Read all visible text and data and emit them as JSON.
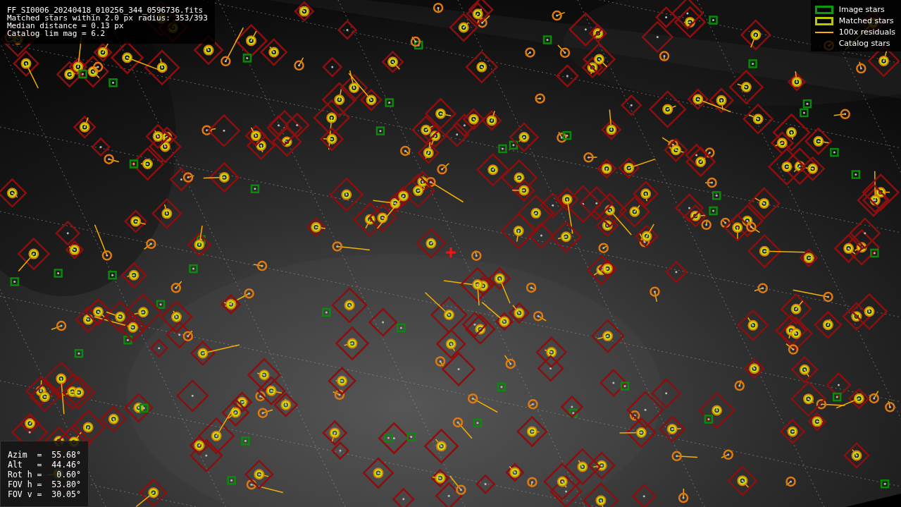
{
  "info_top": {
    "lines": [
      "FF_SI0006_20240418_010256_344_0596736.fits",
      "Matched stars within 2.0 px radius: 353/393",
      "Median distance = 0.13 px",
      "Catalog lim mag = 6.2"
    ]
  },
  "legend": [
    {
      "label": "Image stars"
    },
    {
      "kind": "matched",
      "label": "Matched stars"
    },
    {
      "kind": "residual",
      "label": "100x residuals"
    },
    {
      "kind": "catalog",
      "label": "Catalog stars"
    }
  ],
  "info_bottom": {
    "lines": [
      "Azim  =  55.68°",
      "Alt   =  44.46°",
      "Rot h =   0.60°",
      "FOV h =  53.80°",
      "FOV v =  30.05°"
    ]
  }
}
